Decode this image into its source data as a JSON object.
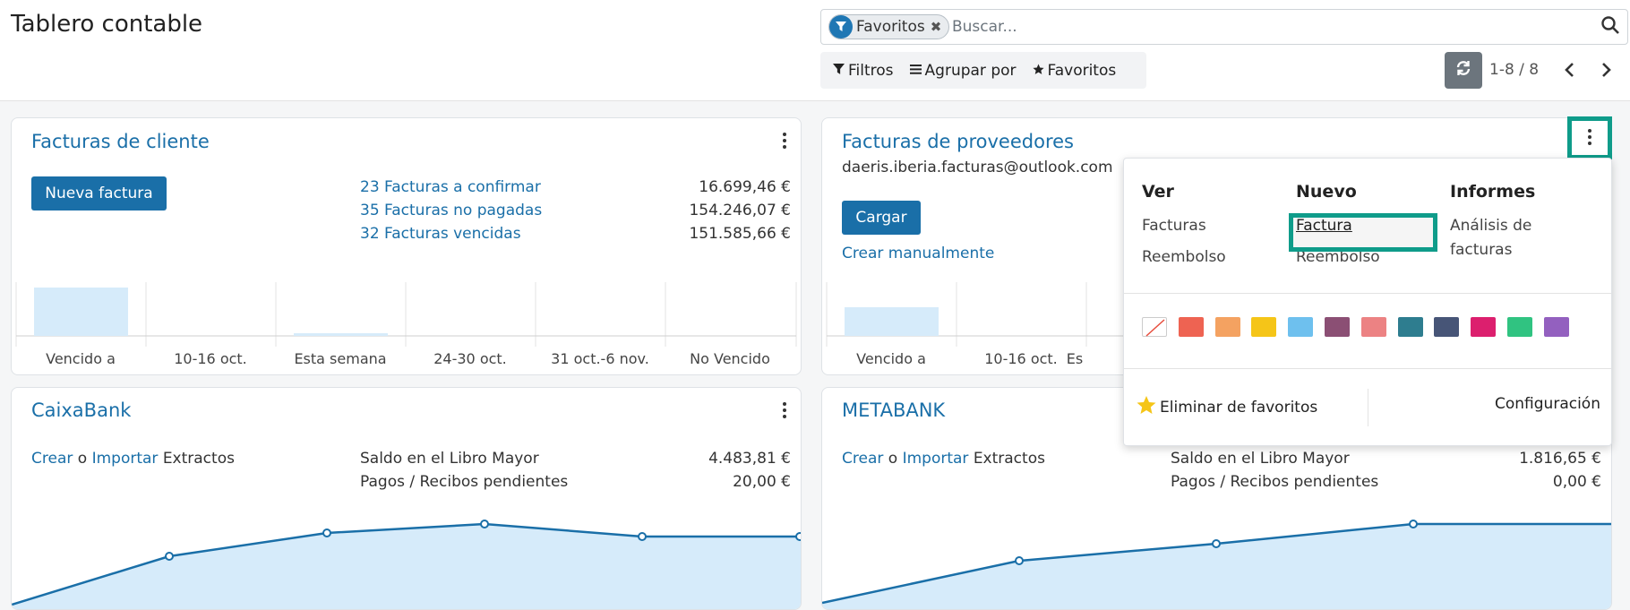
{
  "page_title": "Tablero contable",
  "search": {
    "facet_label": "Favoritos",
    "placeholder": "Buscar..."
  },
  "filter_buttons": {
    "filters": "Filtros",
    "group_by": "Agrupar por",
    "favorites": "Favoritos"
  },
  "pager": {
    "value": "1-8 / 8"
  },
  "colors": {
    "accent": "#1a6fa8",
    "chart_fill": "#d6ebfa",
    "chart_line": "#1a6fa8",
    "highlight": "#0f9c8a"
  },
  "customer_invoices": {
    "title": "Facturas de cliente",
    "new_button": "Nueva factura",
    "rows": [
      {
        "label": "23 Facturas a confirmar",
        "amount": "16.699,46 €"
      },
      {
        "label": "35 Facturas no pagadas",
        "amount": "154.246,07 €"
      },
      {
        "label": "32 Facturas vencidas",
        "amount": "151.585,66 €"
      }
    ],
    "chart_ticks": [
      "Vencido a",
      "10-16 oct.",
      "Esta semana",
      "24-30 oct.",
      "31 oct.-6 nov.",
      "No Vencido"
    ]
  },
  "vendor_bills": {
    "title": "Facturas de proveedores",
    "email": "daeris.iberia.facturas@outlook.com",
    "upload_button": "Cargar",
    "manual_link": "Crear manualmente",
    "chart_ticks": [
      "Vencido a",
      "10-16 oct.",
      "Es"
    ]
  },
  "caixabank": {
    "title": "CaixaBank",
    "create": "Crear",
    "or": "o",
    "import": "Importar",
    "statements": "Extractos",
    "rows": [
      {
        "label": "Saldo en el Libro Mayor",
        "amount": "4.483,81 €"
      },
      {
        "label": "Pagos / Recibos pendientes",
        "amount": "20,00 €"
      }
    ]
  },
  "metabank": {
    "title": "METABANK",
    "create": "Crear",
    "or": "o",
    "import": "Importar",
    "statements": "Extractos",
    "rows": [
      {
        "label": "Saldo en el Libro Mayor",
        "amount": "1.816,65 €"
      },
      {
        "label": "Pagos / Recibos pendientes",
        "amount": "0,00 €"
      }
    ]
  },
  "dropdown": {
    "view": {
      "title": "Ver",
      "items": [
        "Facturas",
        "Reembolso"
      ]
    },
    "new": {
      "title": "Nuevo",
      "items": [
        "Factura",
        "Reembolso"
      ]
    },
    "reports": {
      "title": "Informes",
      "line1": "Análisis de",
      "line2": "facturas"
    },
    "swatches": [
      "#ffffff",
      "#ee6352",
      "#f4a261",
      "#f5c518",
      "#6ec0ee",
      "#8b4f74",
      "#ec8283",
      "#2e7d8f",
      "#475577",
      "#dc1f6e",
      "#30c381",
      "#9360bf"
    ],
    "remove_favorite": "Eliminar de favoritos",
    "settings": "Configuración"
  }
}
